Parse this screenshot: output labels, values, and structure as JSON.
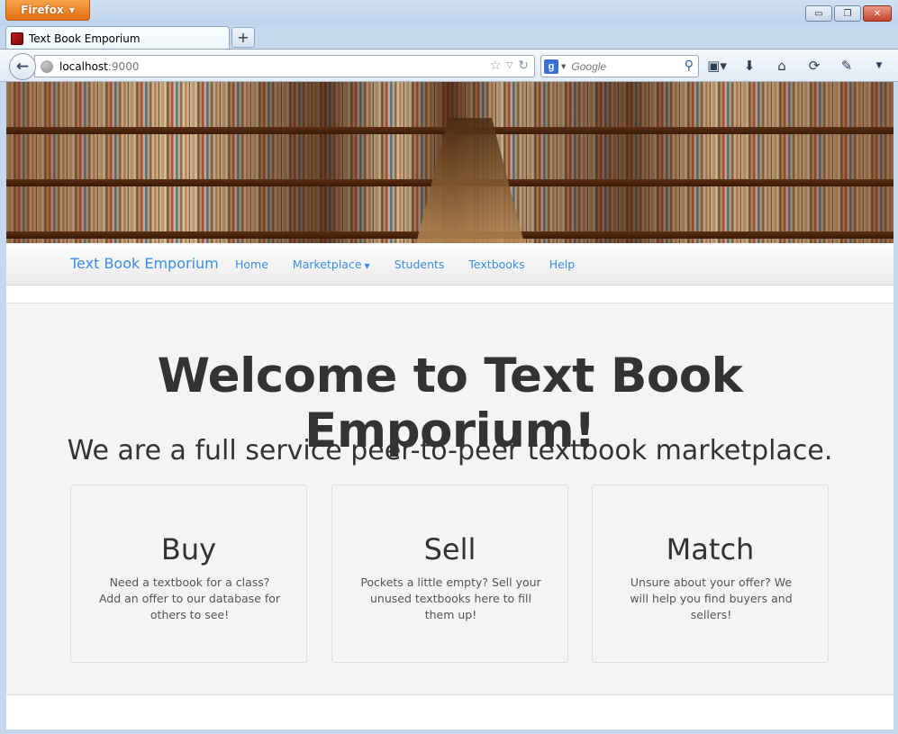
{
  "browser": {
    "app_button_label": "Firefox",
    "window_controls": {
      "minimize": "▭",
      "restore": "❐",
      "close": "✕"
    },
    "tab": {
      "title": "Text Book Emporium"
    },
    "new_tab_label": "+",
    "url": {
      "host": "localhost",
      "port": ":9000"
    },
    "search": {
      "engine_letter": "g",
      "placeholder": "Google"
    }
  },
  "site": {
    "brand": "Text Book Emporium",
    "nav": [
      {
        "label": "Home"
      },
      {
        "label": "Marketplace",
        "has_dropdown": true
      },
      {
        "label": "Students"
      },
      {
        "label": "Textbooks"
      },
      {
        "label": "Help"
      }
    ],
    "hero": {
      "title": "Welcome to Text Book Emporium!",
      "subtitle": "We are a full service peer-to-peer textbook marketplace."
    },
    "cards": [
      {
        "title": "Buy",
        "text": "Need a textbook for a class? Add an offer to our database for others to see!"
      },
      {
        "title": "Sell",
        "text": "Pockets a little empty? Sell your unused textbooks here to fill them up!"
      },
      {
        "title": "Match",
        "text": "Unsure about your offer? We will help you find buyers and sellers!"
      }
    ]
  },
  "colors": {
    "link": "#3a8ee6",
    "jumbotron_bg": "#f4f4f4",
    "firefox_orange": "#e36f0f"
  }
}
